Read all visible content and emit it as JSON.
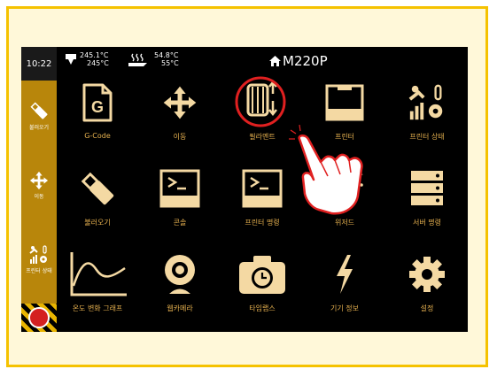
{
  "sidebar": {
    "time": "10:22",
    "items": [
      {
        "label": "불러오기",
        "icon": "usb-icon"
      },
      {
        "label": "이동",
        "icon": "move-arrows-icon"
      },
      {
        "label": "프린터 상태",
        "icon": "printer-status-icon"
      }
    ],
    "stop_icon": "emergency-stop-icon"
  },
  "topbar": {
    "nozzle_current": "245.1°C",
    "nozzle_target": "245°C",
    "bed_current": "54.8°C",
    "bed_target": "55°C",
    "model": "M220P"
  },
  "tiles": [
    {
      "label": "G-Code",
      "icon": "gcode-file-icon"
    },
    {
      "label": "이동",
      "icon": "move-arrows-icon"
    },
    {
      "label": "필라멘트",
      "icon": "filament-spool-icon"
    },
    {
      "label": "프린터",
      "icon": "printer-icon"
    },
    {
      "label": "프린터 상태",
      "icon": "printer-status-icon"
    },
    {
      "label": "불러오기",
      "icon": "usb-icon"
    },
    {
      "label": "콘솔",
      "icon": "console-icon"
    },
    {
      "label": "프린터 명령",
      "icon": "printer-command-icon"
    },
    {
      "label": "위저드",
      "icon": "wizard-wand-icon"
    },
    {
      "label": "서버 명령",
      "icon": "server-command-icon"
    },
    {
      "label": "온도 변화 그래프",
      "icon": "temperature-graph-icon"
    },
    {
      "label": "웹카메라",
      "icon": "webcam-icon"
    },
    {
      "label": "타임랩스",
      "icon": "timelapse-camera-icon"
    },
    {
      "label": "기기 정보",
      "icon": "device-info-icon"
    },
    {
      "label": "설정",
      "icon": "settings-gear-icon"
    }
  ],
  "colors": {
    "accent": "#f4d9a3",
    "label": "#e6b14f",
    "highlight": "#e02020",
    "sidebar": "#b8860b"
  }
}
